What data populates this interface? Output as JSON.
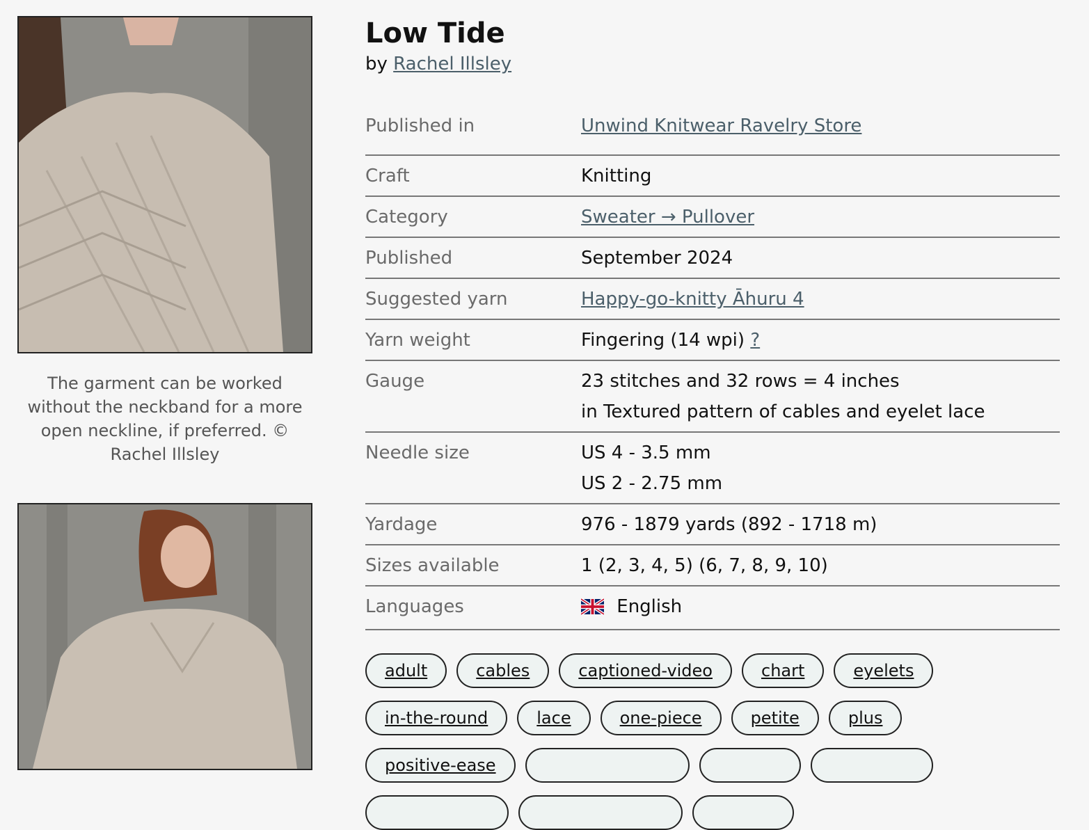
{
  "pattern": {
    "title": "Low Tide",
    "by_prefix": "by",
    "designer": "Rachel Illsley"
  },
  "photos": {
    "caption_1": "The garment can be worked without the neckband for a more open neckline, if preferred. © Rachel Illsley"
  },
  "details": {
    "published_in": {
      "label": "Published in",
      "value": "Unwind Knitwear Ravelry Store"
    },
    "craft": {
      "label": "Craft",
      "value": "Knitting"
    },
    "category": {
      "label": "Category",
      "value": "Sweater → Pullover"
    },
    "published": {
      "label": "Published",
      "value": "September 2024"
    },
    "suggested_yarn": {
      "label": "Suggested yarn",
      "value": "Happy-go-knitty Āhuru 4"
    },
    "yarn_weight": {
      "label": "Yarn weight",
      "value": "Fingering (14 wpi)",
      "help": "?"
    },
    "gauge": {
      "label": "Gauge",
      "line1": "23 stitches and 32 rows = 4 inches",
      "line2": "in Textured pattern of cables and eyelet lace"
    },
    "needle_size": {
      "label": "Needle size",
      "line1": "US 4 - 3.5 mm",
      "line2": "US 2 - 2.75 mm"
    },
    "yardage": {
      "label": "Yardage",
      "value": "976 - 1879 yards (892 - 1718 m)"
    },
    "sizes": {
      "label": "Sizes available",
      "value": "1 (2, 3, 4, 5) (6, 7, 8, 9, 10)"
    },
    "languages": {
      "label": "Languages",
      "value": "English",
      "flag_icon": "uk-flag-icon"
    }
  },
  "tags": [
    "adult",
    "cables",
    "captioned-video",
    "chart",
    "eyelets",
    "in-the-round",
    "lace",
    "one-piece",
    "petite",
    "plus",
    "positive-ease",
    "",
    "",
    "",
    "",
    "",
    ""
  ]
}
